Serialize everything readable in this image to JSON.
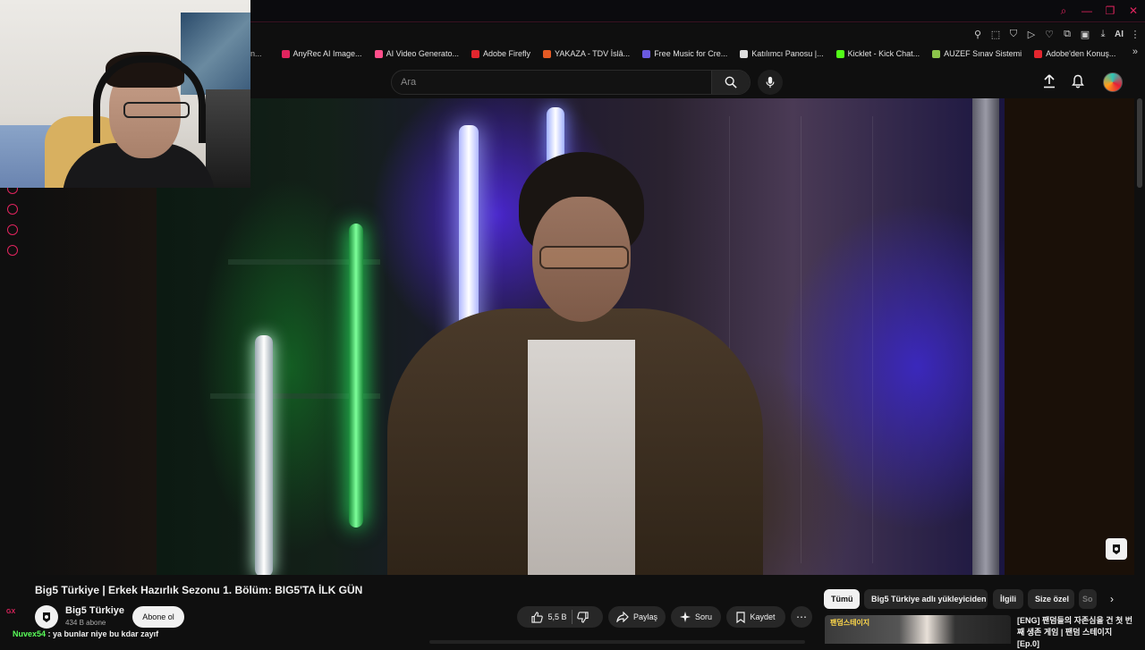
{
  "browser": {
    "window_controls": [
      "⌕",
      "—",
      "❐",
      "✕"
    ],
    "extensions_label": "AI",
    "bookmarks_lead": "n...",
    "bookmarks": [
      {
        "label": "AnyRec AI Image...",
        "color": "#e0245e"
      },
      {
        "label": "AI Video Generato...",
        "color": "#ff4f8b"
      },
      {
        "label": "Adobe Firefly",
        "color": "#e3262e"
      },
      {
        "label": "YAKAZA - TDV İslâ...",
        "color": "#e35a24"
      },
      {
        "label": "Free Music for Cre...",
        "color": "#6a5ae0"
      },
      {
        "label": "Katılımcı Panosu |...",
        "color": "#dddddd"
      },
      {
        "label": "Kicklet - Kick Chat...",
        "color": "#53fc18"
      },
      {
        "label": "AUZEF Sınav Sistemi",
        "color": "#8bc34a"
      },
      {
        "label": "Adobe'den Konuş...",
        "color": "#e3262e"
      }
    ]
  },
  "header": {
    "search_placeholder": "Ara"
  },
  "rail": {
    "gx_label": "GX"
  },
  "video": {
    "title": "Big5 Türkiye | Erkek Hazırlık Sezonu 1. Bölüm: BIG5'TA İLK GÜN"
  },
  "channel": {
    "name": "Big5 Türkiye",
    "subscribers": "434 B abone",
    "subscribe_label": "Abone ol"
  },
  "actions": {
    "likes": "5,5 B",
    "share": "Paylaş",
    "ask": "Soru",
    "save": "Kaydet",
    "more": "⋯"
  },
  "chips": [
    {
      "label": "Tümü",
      "active": true
    },
    {
      "label": "Big5 Türkiye adlı yükleyiciden",
      "active": false
    },
    {
      "label": "İlgili",
      "active": false
    },
    {
      "label": "Size özel",
      "active": false
    },
    {
      "label": "So",
      "active": false
    }
  ],
  "recommendation": {
    "thumb_text": "팬덤스테이지",
    "title": "[ENG] 팬덤들의 자존심을 건 첫 번째 생존 게임 | 팬덤 스테이지 [Ep.0]"
  },
  "chat": {
    "user": "Nuvex54",
    "message": ": ya bunlar niye bu kdar zayıf"
  }
}
